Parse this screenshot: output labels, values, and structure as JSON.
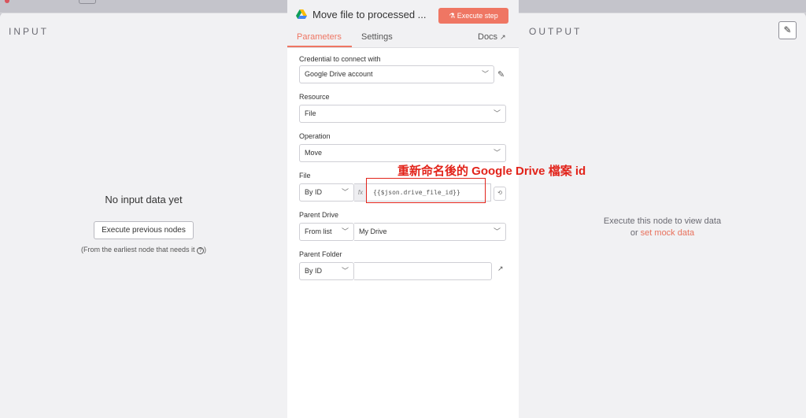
{
  "input": {
    "title": "INPUT",
    "empty_title": "No input data yet",
    "execute_prev_label": "Execute previous nodes",
    "hint": "(From the earliest node that needs it ",
    "hint_close": ")"
  },
  "output": {
    "title": "OUTPUT",
    "message": "Execute this node to view data",
    "or_text": "or ",
    "mock_link": "set mock data"
  },
  "node": {
    "title": "Move file to processed ...",
    "execute_label": "Execute step",
    "tabs": {
      "parameters": "Parameters",
      "settings": "Settings",
      "docs": "Docs"
    }
  },
  "form": {
    "credential": {
      "label": "Credential to connect with",
      "value": "Google Drive account"
    },
    "resource": {
      "label": "Resource",
      "value": "File"
    },
    "operation": {
      "label": "Operation",
      "value": "Move"
    },
    "file": {
      "label": "File",
      "mode": "By ID",
      "fx": "fx",
      "expression": "{{$json.drive_file_id}}"
    },
    "parent_drive": {
      "label": "Parent Drive",
      "mode": "From list",
      "value": "My Drive"
    },
    "parent_folder": {
      "label": "Parent Folder",
      "mode": "By ID",
      "value": ""
    }
  },
  "annotation": {
    "text": "重新命名後的 Google Drive 檔案 id",
    "color": "#e2231a"
  },
  "colors": {
    "accent": "#ef7663",
    "annotation": "#e2231a"
  },
  "icons": [
    "google-drive-icon",
    "flask-icon",
    "external-link-icon",
    "pencil-icon",
    "chevron-down-icon",
    "help-icon",
    "reset-icon"
  ]
}
